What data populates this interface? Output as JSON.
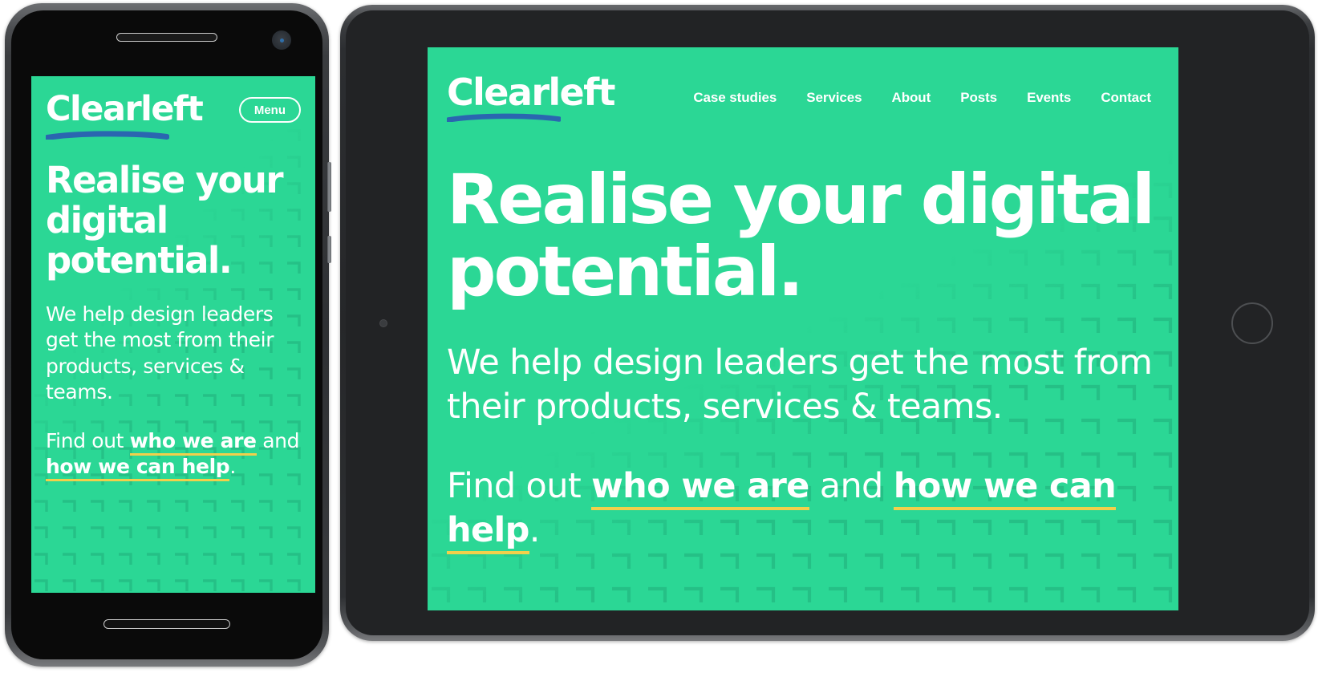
{
  "colors": {
    "brand_green": "#2bd795",
    "logo_underline_blue": "#2a66b0",
    "link_underline_yellow": "#f2d04b",
    "text_white": "#ffffff",
    "pattern_green": "#25c086",
    "phone_body": "#2e3033",
    "tablet_body": "#262729"
  },
  "phone": {
    "device_name": "smartphone",
    "site": {
      "logo": "Clearleft",
      "menu_button": "Menu",
      "headline": "Realise your digital potential.",
      "lede": "We help design leaders get the most from their products, services & teams.",
      "findout": {
        "prefix": "Find out ",
        "link1": "who we are",
        "middle": " and ",
        "link2": "how we can help",
        "suffix": "."
      }
    }
  },
  "tablet": {
    "device_name": "tablet",
    "site": {
      "logo": "Clearleft",
      "nav": [
        {
          "label": "Case studies"
        },
        {
          "label": "Services"
        },
        {
          "label": "About"
        },
        {
          "label": "Posts"
        },
        {
          "label": "Events"
        },
        {
          "label": "Contact"
        }
      ],
      "headline": "Realise your digital potential.",
      "lede": "We help design leaders get the most from their products, services & teams.",
      "findout": {
        "prefix": "Find out ",
        "link1": "who we are",
        "middle": " and ",
        "link2": "how we can help",
        "suffix": "."
      }
    }
  }
}
